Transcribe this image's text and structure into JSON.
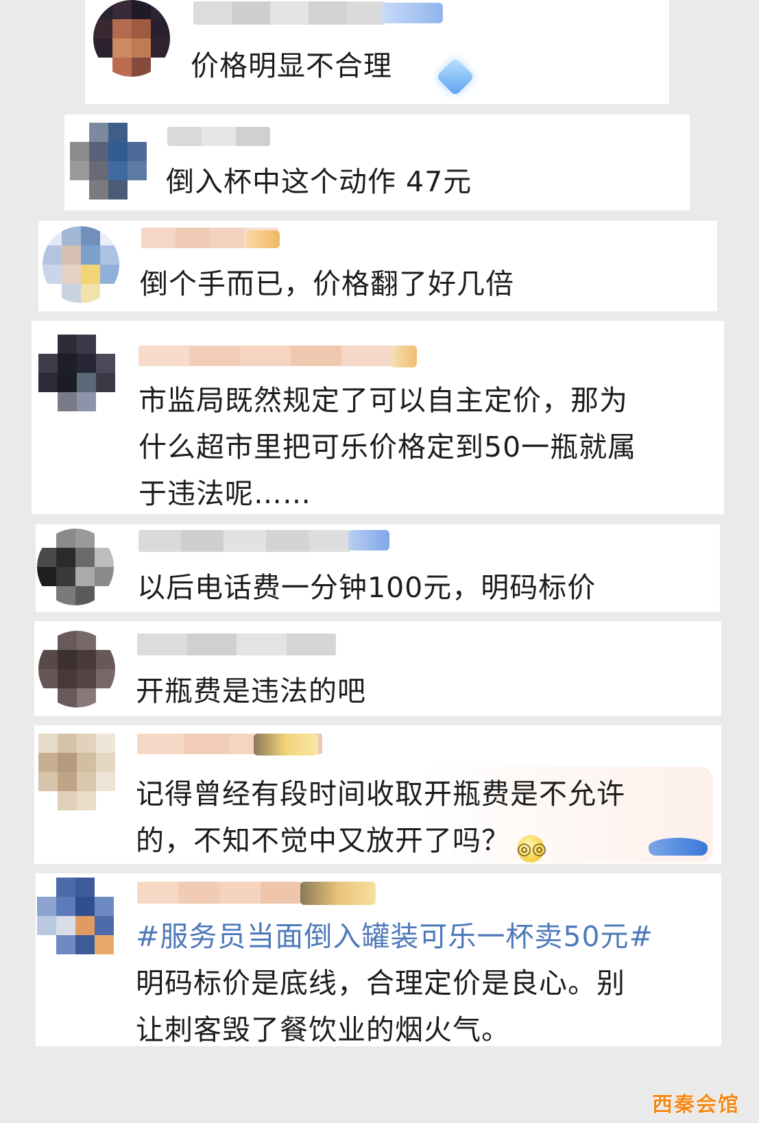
{
  "comments": [
    {
      "text_lines": [
        "价格明显不合理"
      ]
    },
    {
      "text_lines": [
        "倒入杯中这个动作 47元"
      ]
    },
    {
      "text_lines": [
        "倒个手而已，价格翻了好几倍"
      ]
    },
    {
      "text_lines": [
        "市监局既然规定了可以自主定价，那为",
        "什么超市里把可乐价格定到50一瓶就属",
        "于违法呢……"
      ]
    },
    {
      "text_lines": [
        "以后电话费一分钟100元，明码标价"
      ]
    },
    {
      "text_lines": [
        "开瓶费是违法的吧"
      ]
    },
    {
      "text_lines": [
        "记得曾经有段时间收取开瓶费是不允许",
        "的，不知不觉中又放开了吗？"
      ],
      "emoji": "glasses-emoji"
    },
    {
      "hashtag": "#服务员当面倒入罐装可乐一杯卖50元#",
      "text_lines": [
        "明码标价是底线，合理定价是良心。别",
        "让刺客毁了餐饮业的烟火气。"
      ]
    }
  ],
  "watermark": "西秦会馆",
  "colors": {
    "accent_link": "#4e79b9",
    "watermark": "#f28a1a",
    "background": "#eaeaea"
  },
  "icons": [
    "diamond-badge-icon",
    "fan-badge-icon",
    "glasses-emoji-icon",
    "whale-decoration-icon"
  ]
}
